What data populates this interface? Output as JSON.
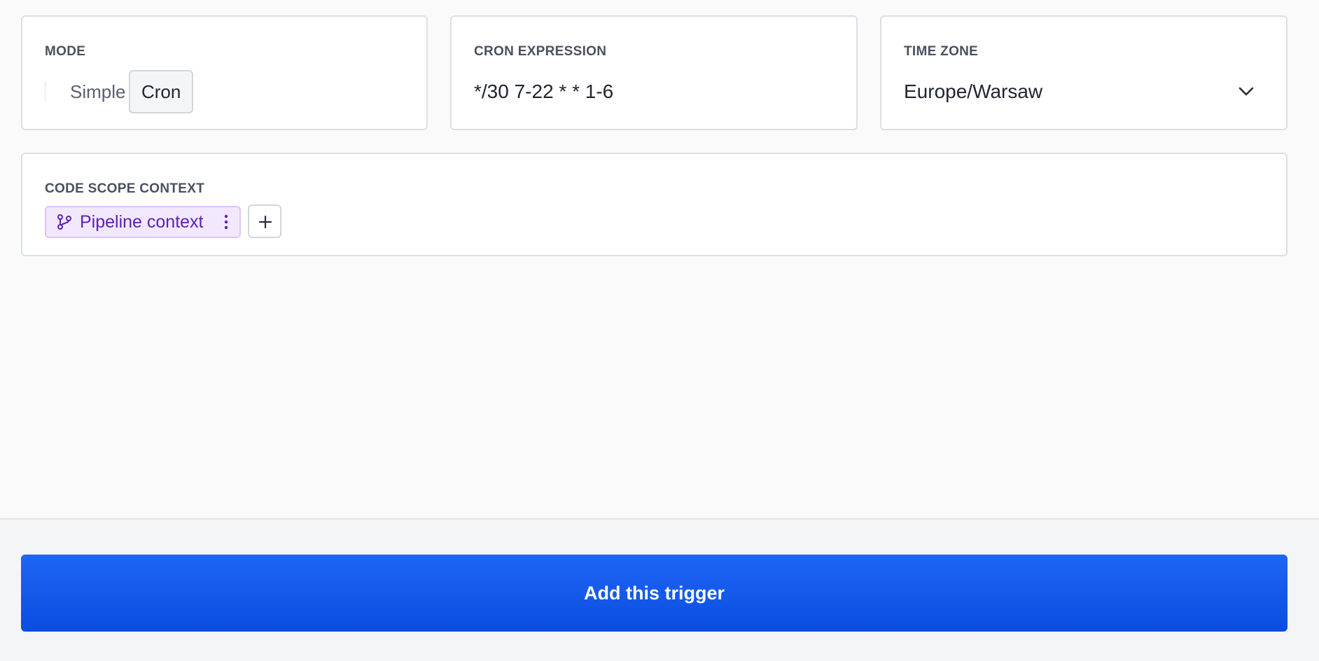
{
  "mode": {
    "label": "MODE",
    "options": [
      "Simple",
      "Cron"
    ],
    "selected": "Cron"
  },
  "cron": {
    "label": "CRON EXPRESSION",
    "value": "*/30 7-22 * * 1-6"
  },
  "timezone": {
    "label": "TIME ZONE",
    "value": "Europe/Warsaw",
    "icon": "chevron-down-icon"
  },
  "code_scope": {
    "label": "CODE SCOPE CONTEXT",
    "chips": [
      {
        "label": "Pipeline context",
        "icon": "branch-icon",
        "menu_icon": "more-vertical-icon"
      }
    ],
    "add_icon": "plus-icon"
  },
  "footer": {
    "submit_label": "Add this trigger"
  },
  "colors": {
    "accent": "#1a5cf0",
    "chip_bg": "#f2e8fd",
    "chip_text": "#5b21b6",
    "page_bg": "#fafafa"
  }
}
